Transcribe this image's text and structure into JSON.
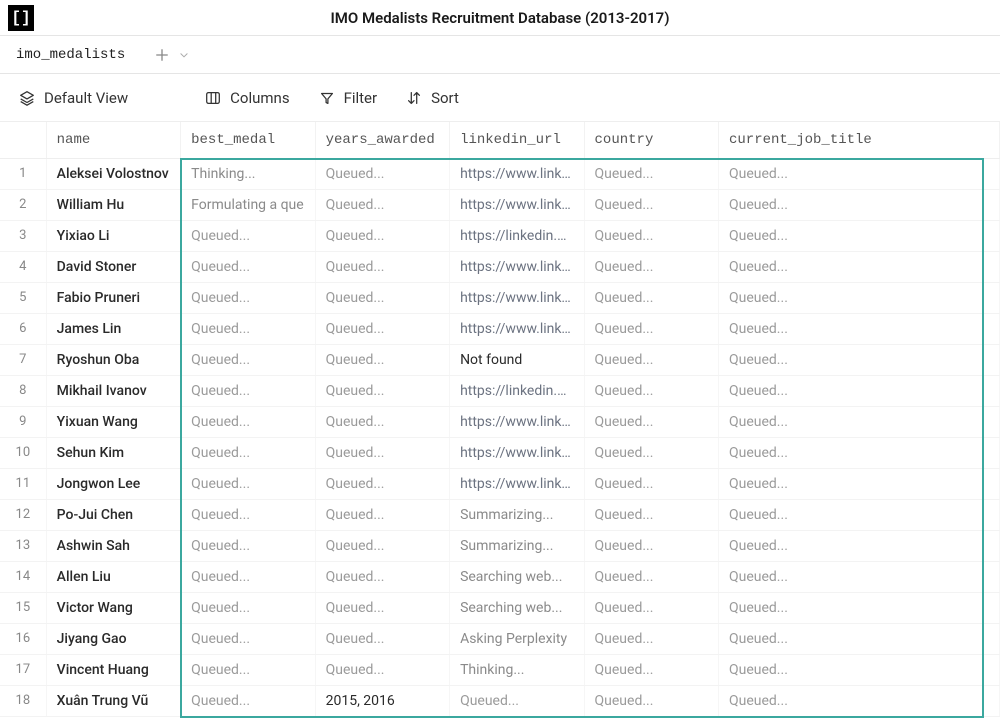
{
  "app_title": "IMO Medalists Recruitment Database (2013-2017)",
  "tab_name": "imo_medalists",
  "toolbar": {
    "view_label": "Default View",
    "columns_label": "Columns",
    "filter_label": "Filter",
    "sort_label": "Sort"
  },
  "columns": {
    "name": "name",
    "best_medal": "best_medal",
    "years_awarded": "years_awarded",
    "linkedin_url": "linkedin_url",
    "country": "country",
    "current_job_title": "current_job_title"
  },
  "rows": [
    {
      "n": "1",
      "name": "Aleksei Volostnov",
      "best": "Thinking...",
      "years": "Queued...",
      "link": "https://www.linked",
      "country": "Queued...",
      "job": "Queued..."
    },
    {
      "n": "2",
      "name": "William Hu",
      "best": "Formulating a que",
      "years": "Queued...",
      "link": "https://www.linked",
      "country": "Queued...",
      "job": "Queued..."
    },
    {
      "n": "3",
      "name": "Yixiao Li",
      "best": "Queued...",
      "years": "Queued...",
      "link": "https://linkedin.com",
      "country": "Queued...",
      "job": "Queued..."
    },
    {
      "n": "4",
      "name": "David Stoner",
      "best": "Queued...",
      "years": "Queued...",
      "link": "https://www.linked",
      "country": "Queued...",
      "job": "Queued..."
    },
    {
      "n": "5",
      "name": "Fabio Pruneri",
      "best": "Queued...",
      "years": "Queued...",
      "link": "https://www.linked",
      "country": "Queued...",
      "job": "Queued..."
    },
    {
      "n": "6",
      "name": "James Lin",
      "best": "Queued...",
      "years": "Queued...",
      "link": "https://www.linked",
      "country": "Queued...",
      "job": "Queued..."
    },
    {
      "n": "7",
      "name": "Ryoshun Oba",
      "best": "Queued...",
      "years": "Queued...",
      "link": "Not found",
      "country": "Queued...",
      "job": "Queued..."
    },
    {
      "n": "8",
      "name": "Mikhail Ivanov",
      "best": "Queued...",
      "years": "Queued...",
      "link": "https://linkedin.com",
      "country": "Queued...",
      "job": "Queued..."
    },
    {
      "n": "9",
      "name": "Yixuan Wang",
      "best": "Queued...",
      "years": "Queued...",
      "link": "https://www.linked",
      "country": "Queued...",
      "job": "Queued..."
    },
    {
      "n": "10",
      "name": "Sehun Kim",
      "best": "Queued...",
      "years": "Queued...",
      "link": "https://www.linked",
      "country": "Queued...",
      "job": "Queued..."
    },
    {
      "n": "11",
      "name": "Jongwon Lee",
      "best": "Queued...",
      "years": "Queued...",
      "link": "https://www.linked",
      "country": "Queued...",
      "job": "Queued..."
    },
    {
      "n": "12",
      "name": "Po-Jui Chen",
      "best": "Queued...",
      "years": "Queued...",
      "link": "Summarizing...",
      "country": "Queued...",
      "job": "Queued..."
    },
    {
      "n": "13",
      "name": "Ashwin Sah",
      "best": "Queued...",
      "years": "Queued...",
      "link": "Summarizing...",
      "country": "Queued...",
      "job": "Queued..."
    },
    {
      "n": "14",
      "name": "Allen Liu",
      "best": "Queued...",
      "years": "Queued...",
      "link": "Searching web...",
      "country": "Queued...",
      "job": "Queued..."
    },
    {
      "n": "15",
      "name": "Victor Wang",
      "best": "Queued...",
      "years": "Queued...",
      "link": "Searching web...",
      "country": "Queued...",
      "job": "Queued..."
    },
    {
      "n": "16",
      "name": "Jiyang Gao",
      "best": "Queued...",
      "years": "Queued...",
      "link": "Asking Perplexity",
      "country": "Queued...",
      "job": "Queued..."
    },
    {
      "n": "17",
      "name": "Vincent Huang",
      "best": "Queued...",
      "years": "Queued...",
      "link": "Thinking...",
      "country": "Queued...",
      "job": "Queued..."
    },
    {
      "n": "18",
      "name": "Xuân Trung Vũ",
      "best": "Queued...",
      "years": "2015, 2016",
      "link": "Queued...",
      "country": "Queued...",
      "job": "Queued..."
    }
  ]
}
